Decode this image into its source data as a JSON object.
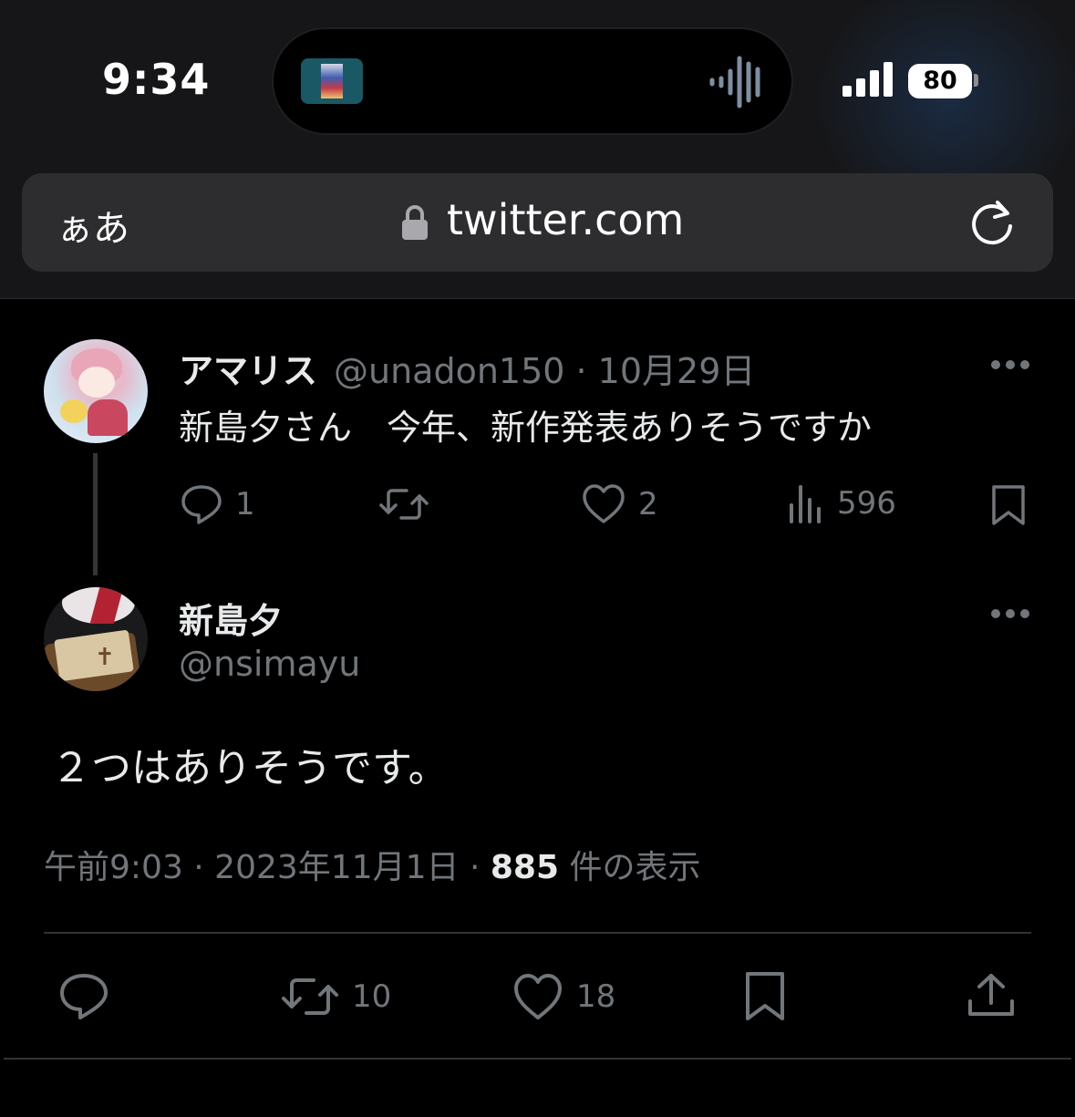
{
  "status_bar": {
    "time": "9:34",
    "battery": "80",
    "icons": [
      "now-playing-album-icon",
      "audio-waveform-icon",
      "cellular-signal-icon",
      "battery-icon"
    ]
  },
  "browser": {
    "text_size_button": "ぁあ",
    "url": "twitter.com",
    "icons": [
      "lock-icon",
      "reload-icon"
    ]
  },
  "parent_tweet": {
    "display_name": "アマリス",
    "meta": "@unadon150 · 10月29日",
    "text": "新島夕さん　今年、新作発表ありそうですか",
    "actions": {
      "replies": "1",
      "retweets": "",
      "likes": "2",
      "views": "596"
    }
  },
  "main_tweet": {
    "display_name": "新島夕",
    "handle": "@nsimayu",
    "text": "２つはありそうです。",
    "timestamp": "午前9:03 · 2023年11月1日 · ",
    "view_count": "885",
    "view_label": " 件の表示",
    "actions": {
      "retweets": "10",
      "likes": "18"
    }
  },
  "colors": {
    "background": "#000000",
    "browser_chrome": "#161618",
    "url_bar": "#2d2d30",
    "text_primary": "#e7e9ea",
    "text_secondary": "#71767b",
    "divider": "#2f3336"
  }
}
